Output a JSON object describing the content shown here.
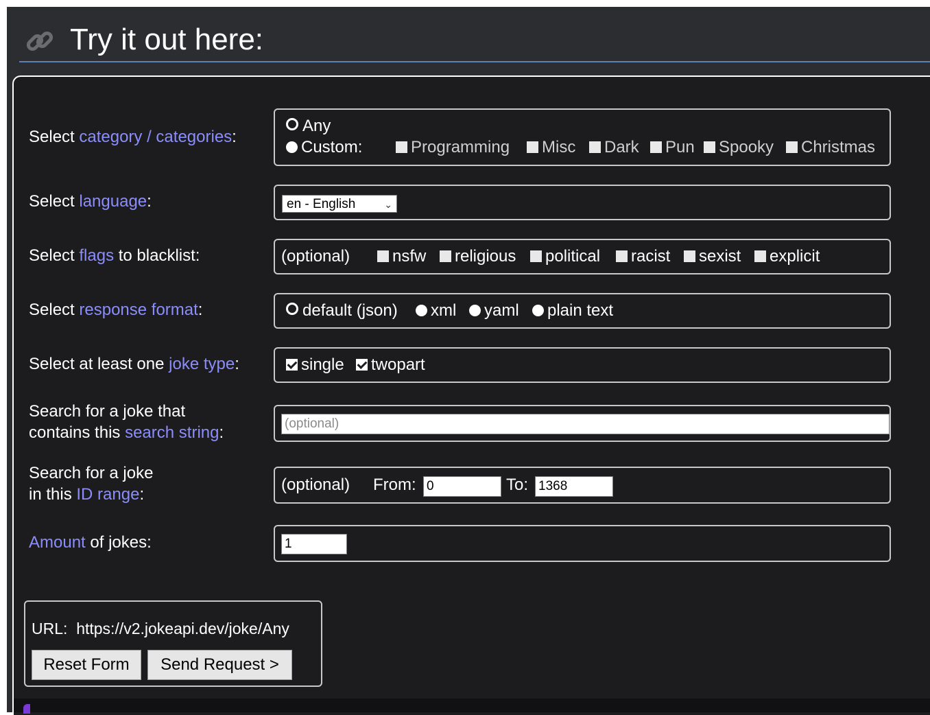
{
  "header": {
    "title": "Try it out here:",
    "icon": "link-icon"
  },
  "rows": {
    "category": {
      "label_pre": "Select ",
      "label_accent": "category / categories",
      "label_post": ":"
    },
    "language": {
      "label_pre": "Select ",
      "label_accent": "language",
      "label_post": ":"
    },
    "flags": {
      "label_pre": "Select ",
      "label_accent": "flags",
      "label_post": " to blacklist:"
    },
    "format": {
      "label_pre": "Select ",
      "label_accent": "response format",
      "label_post": ":"
    },
    "joketype": {
      "label_pre": "Select at least one ",
      "label_accent": "joke type",
      "label_post": ":"
    },
    "search": {
      "label_line1": "Search for a joke that",
      "label_pre": "contains this ",
      "label_accent": "search string",
      "label_post": ":"
    },
    "idrange": {
      "label_line1": "Search for a joke",
      "label_pre": "in this ",
      "label_accent": "ID range",
      "label_post": ":"
    },
    "amount": {
      "label_accent": "Amount",
      "label_post": " of jokes:"
    }
  },
  "category": {
    "any_label": "Any",
    "custom_label": "Custom:",
    "selected": "Any",
    "options": [
      "Programming",
      "Misc",
      "Dark",
      "Pun",
      "Spooky",
      "Christmas"
    ]
  },
  "language": {
    "selected": "en - English"
  },
  "flags": {
    "optional_label": "(optional)",
    "options": [
      "nsfw",
      "religious",
      "political",
      "racist",
      "sexist",
      "explicit"
    ]
  },
  "format": {
    "selected": "default (json)",
    "options": [
      "default (json)",
      "xml",
      "yaml",
      "plain text"
    ]
  },
  "joketype": {
    "options": [
      {
        "label": "single",
        "checked": true
      },
      {
        "label": "twopart",
        "checked": true
      }
    ]
  },
  "search": {
    "placeholder": "(optional)",
    "value": ""
  },
  "idrange": {
    "optional_label": "(optional)",
    "from_label": "From:",
    "from_value": "0",
    "to_label": "To:",
    "to_value": "1368"
  },
  "amount": {
    "value": "1"
  },
  "url": {
    "label": "URL:",
    "value": "https://v2.jokeapi.dev/joke/Any"
  },
  "buttons": {
    "reset": "Reset Form",
    "send": "Send Request >"
  },
  "colors": {
    "accent": "#8b8dfb",
    "background": "#2b2d31",
    "panel": "#1c1c1e",
    "header_rule": "#5f7fb5"
  }
}
